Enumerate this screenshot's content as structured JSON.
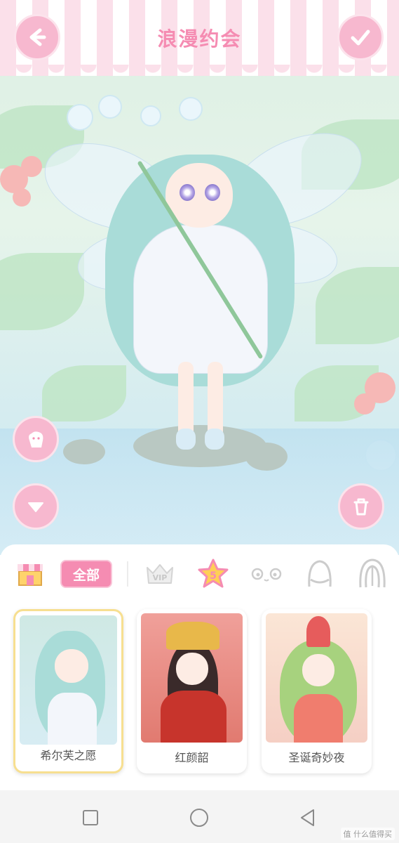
{
  "header": {
    "title": "浪漫约会"
  },
  "colors": {
    "accent_pink": "#f58cb2",
    "button_pink": "#f7b8cf",
    "selected_border": "#f7df90"
  },
  "icons": {
    "back": "arrow-left-icon",
    "confirm": "check-icon",
    "pose": "hand-pose-icon",
    "collapse": "chevron-down-icon",
    "delete": "trash-icon"
  },
  "tabs": [
    {
      "id": "shop",
      "icon": "shop-icon"
    },
    {
      "id": "all",
      "label": "全部"
    },
    {
      "id": "vip",
      "label": "VIP",
      "icon": "crown-icon"
    },
    {
      "id": "star",
      "label": "5",
      "icon": "star-icon"
    },
    {
      "id": "face",
      "icon": "face-icon"
    },
    {
      "id": "head",
      "icon": "head-icon"
    },
    {
      "id": "hair",
      "icon": "hair-icon"
    }
  ],
  "outfits": [
    {
      "name": "希尔芙之愿",
      "selected": true
    },
    {
      "name": "红颜韶",
      "selected": false
    },
    {
      "name": "圣诞奇妙夜",
      "selected": false
    }
  ],
  "navbar": {
    "icons": [
      "square-icon",
      "circle-home-icon",
      "triangle-back-icon"
    ],
    "watermark": "值 什么值得买"
  }
}
